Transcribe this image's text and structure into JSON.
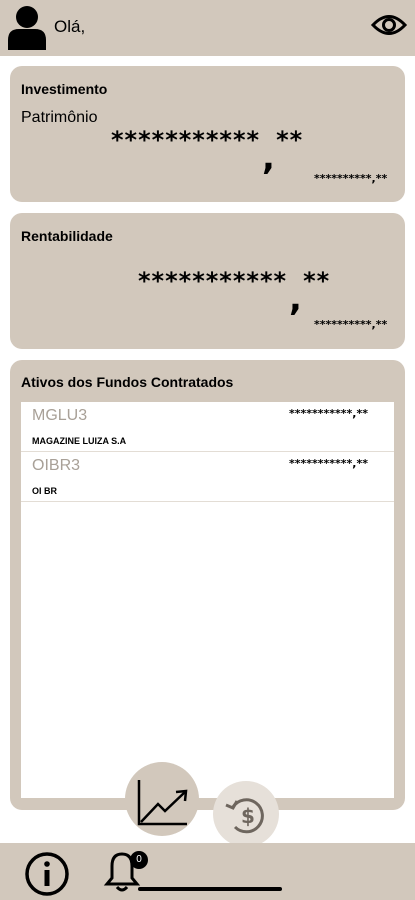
{
  "header": {
    "greeting": "Olá,",
    "avatar_icon": "user-avatar-icon",
    "visibility_icon": "eye-icon"
  },
  "investimento": {
    "title": "Investimento",
    "label": "Patrimônio",
    "masked_value": "***********",
    "masked_cents": "**",
    "masked_secondary": "**********,**"
  },
  "rentabilidade": {
    "title": "Rentabilidade",
    "masked_value": "***********",
    "masked_cents": "**",
    "masked_secondary": "**********,**"
  },
  "ativos": {
    "title": "Ativos dos Fundos Contratados",
    "items": [
      {
        "ticker": "MGLU3",
        "name": "MAGAZINE LUIZA S.A",
        "value": "***********,**"
      },
      {
        "ticker": "OIBR3",
        "name": "OI BR",
        "value": "***********,**"
      }
    ]
  },
  "fabs": {
    "chart_icon": "trending-up-chart-icon",
    "money_icon": "money-refresh-icon"
  },
  "bottom_nav": {
    "info_icon": "info-icon",
    "bell_icon": "bell-icon",
    "notification_count": "0"
  },
  "colors": {
    "accent": "#d2c8bc",
    "accent_light": "#e6e0d9",
    "ticker_gray": "#a8a097"
  }
}
